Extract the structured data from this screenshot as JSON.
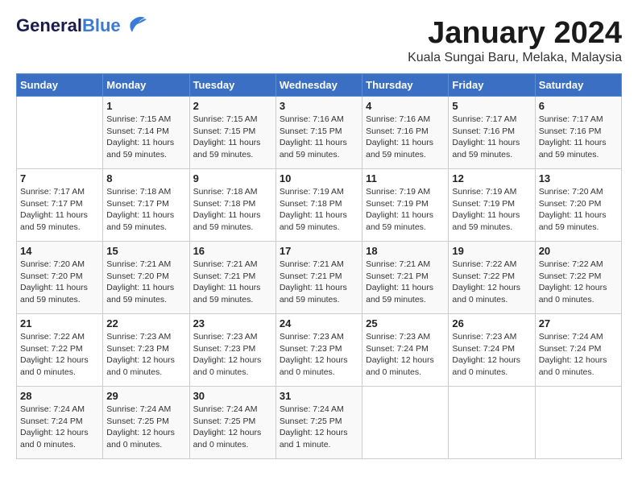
{
  "logo": {
    "general": "General",
    "blue": "Blue"
  },
  "title": "January 2024",
  "location": "Kuala Sungai Baru, Melaka, Malaysia",
  "days_header": [
    "Sunday",
    "Monday",
    "Tuesday",
    "Wednesday",
    "Thursday",
    "Friday",
    "Saturday"
  ],
  "weeks": [
    [
      {
        "num": "",
        "sunrise": "",
        "sunset": "",
        "daylight": ""
      },
      {
        "num": "1",
        "sunrise": "Sunrise: 7:15 AM",
        "sunset": "Sunset: 7:14 PM",
        "daylight": "Daylight: 11 hours and 59 minutes."
      },
      {
        "num": "2",
        "sunrise": "Sunrise: 7:15 AM",
        "sunset": "Sunset: 7:15 PM",
        "daylight": "Daylight: 11 hours and 59 minutes."
      },
      {
        "num": "3",
        "sunrise": "Sunrise: 7:16 AM",
        "sunset": "Sunset: 7:15 PM",
        "daylight": "Daylight: 11 hours and 59 minutes."
      },
      {
        "num": "4",
        "sunrise": "Sunrise: 7:16 AM",
        "sunset": "Sunset: 7:16 PM",
        "daylight": "Daylight: 11 hours and 59 minutes."
      },
      {
        "num": "5",
        "sunrise": "Sunrise: 7:17 AM",
        "sunset": "Sunset: 7:16 PM",
        "daylight": "Daylight: 11 hours and 59 minutes."
      },
      {
        "num": "6",
        "sunrise": "Sunrise: 7:17 AM",
        "sunset": "Sunset: 7:16 PM",
        "daylight": "Daylight: 11 hours and 59 minutes."
      }
    ],
    [
      {
        "num": "7",
        "sunrise": "Sunrise: 7:17 AM",
        "sunset": "Sunset: 7:17 PM",
        "daylight": "Daylight: 11 hours and 59 minutes."
      },
      {
        "num": "8",
        "sunrise": "Sunrise: 7:18 AM",
        "sunset": "Sunset: 7:17 PM",
        "daylight": "Daylight: 11 hours and 59 minutes."
      },
      {
        "num": "9",
        "sunrise": "Sunrise: 7:18 AM",
        "sunset": "Sunset: 7:18 PM",
        "daylight": "Daylight: 11 hours and 59 minutes."
      },
      {
        "num": "10",
        "sunrise": "Sunrise: 7:19 AM",
        "sunset": "Sunset: 7:18 PM",
        "daylight": "Daylight: 11 hours and 59 minutes."
      },
      {
        "num": "11",
        "sunrise": "Sunrise: 7:19 AM",
        "sunset": "Sunset: 7:19 PM",
        "daylight": "Daylight: 11 hours and 59 minutes."
      },
      {
        "num": "12",
        "sunrise": "Sunrise: 7:19 AM",
        "sunset": "Sunset: 7:19 PM",
        "daylight": "Daylight: 11 hours and 59 minutes."
      },
      {
        "num": "13",
        "sunrise": "Sunrise: 7:20 AM",
        "sunset": "Sunset: 7:20 PM",
        "daylight": "Daylight: 11 hours and 59 minutes."
      }
    ],
    [
      {
        "num": "14",
        "sunrise": "Sunrise: 7:20 AM",
        "sunset": "Sunset: 7:20 PM",
        "daylight": "Daylight: 11 hours and 59 minutes."
      },
      {
        "num": "15",
        "sunrise": "Sunrise: 7:21 AM",
        "sunset": "Sunset: 7:20 PM",
        "daylight": "Daylight: 11 hours and 59 minutes."
      },
      {
        "num": "16",
        "sunrise": "Sunrise: 7:21 AM",
        "sunset": "Sunset: 7:21 PM",
        "daylight": "Daylight: 11 hours and 59 minutes."
      },
      {
        "num": "17",
        "sunrise": "Sunrise: 7:21 AM",
        "sunset": "Sunset: 7:21 PM",
        "daylight": "Daylight: 11 hours and 59 minutes."
      },
      {
        "num": "18",
        "sunrise": "Sunrise: 7:21 AM",
        "sunset": "Sunset: 7:21 PM",
        "daylight": "Daylight: 11 hours and 59 minutes."
      },
      {
        "num": "19",
        "sunrise": "Sunrise: 7:22 AM",
        "sunset": "Sunset: 7:22 PM",
        "daylight": "Daylight: 12 hours and 0 minutes."
      },
      {
        "num": "20",
        "sunrise": "Sunrise: 7:22 AM",
        "sunset": "Sunset: 7:22 PM",
        "daylight": "Daylight: 12 hours and 0 minutes."
      }
    ],
    [
      {
        "num": "21",
        "sunrise": "Sunrise: 7:22 AM",
        "sunset": "Sunset: 7:22 PM",
        "daylight": "Daylight: 12 hours and 0 minutes."
      },
      {
        "num": "22",
        "sunrise": "Sunrise: 7:23 AM",
        "sunset": "Sunset: 7:23 PM",
        "daylight": "Daylight: 12 hours and 0 minutes."
      },
      {
        "num": "23",
        "sunrise": "Sunrise: 7:23 AM",
        "sunset": "Sunset: 7:23 PM",
        "daylight": "Daylight: 12 hours and 0 minutes."
      },
      {
        "num": "24",
        "sunrise": "Sunrise: 7:23 AM",
        "sunset": "Sunset: 7:23 PM",
        "daylight": "Daylight: 12 hours and 0 minutes."
      },
      {
        "num": "25",
        "sunrise": "Sunrise: 7:23 AM",
        "sunset": "Sunset: 7:24 PM",
        "daylight": "Daylight: 12 hours and 0 minutes."
      },
      {
        "num": "26",
        "sunrise": "Sunrise: 7:23 AM",
        "sunset": "Sunset: 7:24 PM",
        "daylight": "Daylight: 12 hours and 0 minutes."
      },
      {
        "num": "27",
        "sunrise": "Sunrise: 7:24 AM",
        "sunset": "Sunset: 7:24 PM",
        "daylight": "Daylight: 12 hours and 0 minutes."
      }
    ],
    [
      {
        "num": "28",
        "sunrise": "Sunrise: 7:24 AM",
        "sunset": "Sunset: 7:24 PM",
        "daylight": "Daylight: 12 hours and 0 minutes."
      },
      {
        "num": "29",
        "sunrise": "Sunrise: 7:24 AM",
        "sunset": "Sunset: 7:25 PM",
        "daylight": "Daylight: 12 hours and 0 minutes."
      },
      {
        "num": "30",
        "sunrise": "Sunrise: 7:24 AM",
        "sunset": "Sunset: 7:25 PM",
        "daylight": "Daylight: 12 hours and 0 minutes."
      },
      {
        "num": "31",
        "sunrise": "Sunrise: 7:24 AM",
        "sunset": "Sunset: 7:25 PM",
        "daylight": "Daylight: 12 hours and 1 minute."
      },
      {
        "num": "",
        "sunrise": "",
        "sunset": "",
        "daylight": ""
      },
      {
        "num": "",
        "sunrise": "",
        "sunset": "",
        "daylight": ""
      },
      {
        "num": "",
        "sunrise": "",
        "sunset": "",
        "daylight": ""
      }
    ]
  ]
}
